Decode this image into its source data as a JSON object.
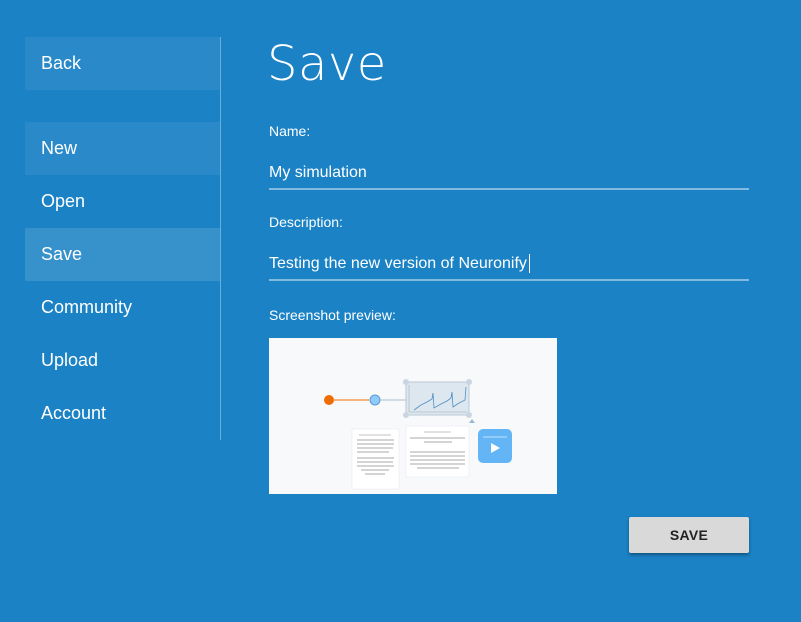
{
  "sidebar": {
    "back_label": "Back",
    "items": [
      {
        "label": "New"
      },
      {
        "label": "Open"
      },
      {
        "label": "Save"
      },
      {
        "label": "Community"
      },
      {
        "label": "Upload"
      },
      {
        "label": "Account"
      }
    ]
  },
  "main": {
    "title": "Save",
    "name_label": "Name:",
    "name_value": "My simulation",
    "description_label": "Description:",
    "description_value": "Testing the new version of Neuronify",
    "preview_label": "Screenshot preview:",
    "save_label": "SAVE"
  },
  "colors": {
    "background": "#1a82c5",
    "button": "#d9d9d9",
    "preview_accent": "#64b5f6",
    "preview_source": "#ef6c00"
  }
}
